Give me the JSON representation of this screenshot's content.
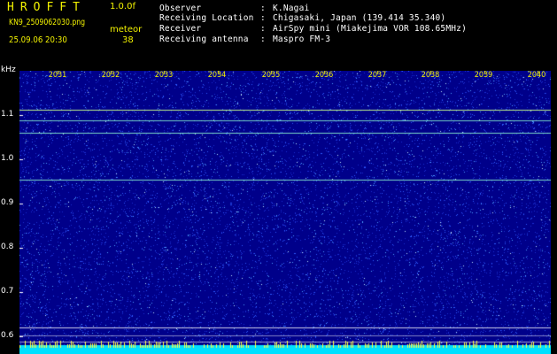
{
  "app": {
    "title": "HROFFT",
    "version": "1.0.0f",
    "filename": "KN9_2509062030.png",
    "mode": "meteor",
    "datetime": "25.09.06 20:30",
    "count": "38"
  },
  "info": [
    {
      "label": "Observer",
      "value": "K.Nagai"
    },
    {
      "label": "Receiving Location",
      "value": "Chigasaki, Japan (139.414 35.340)"
    },
    {
      "label": "Receiver",
      "value": "AirSpy mini (Miakejima VOR 108.65MHz)"
    },
    {
      "label": "Receiving antenna",
      "value": "Maspro FM-3"
    }
  ],
  "separator": ":",
  "y_axis": {
    "unit": "kHz",
    "ticks": [
      "1.1",
      "1.0",
      "0.9",
      "0.8",
      "0.7",
      "0.6"
    ]
  },
  "x_axis": {
    "ticks": [
      "2031",
      "2032",
      "2033",
      "2034",
      "2035",
      "2036",
      "2037",
      "2038",
      "2039",
      "2040"
    ]
  },
  "colors": {
    "background": "#000000",
    "plot_background": "#00008a",
    "noise": "#3a6cff",
    "trace": "#6cffd0",
    "bottom_band": "#00e0ff",
    "label_yellow": "#f2f200",
    "label_white": "#ffffff"
  }
}
